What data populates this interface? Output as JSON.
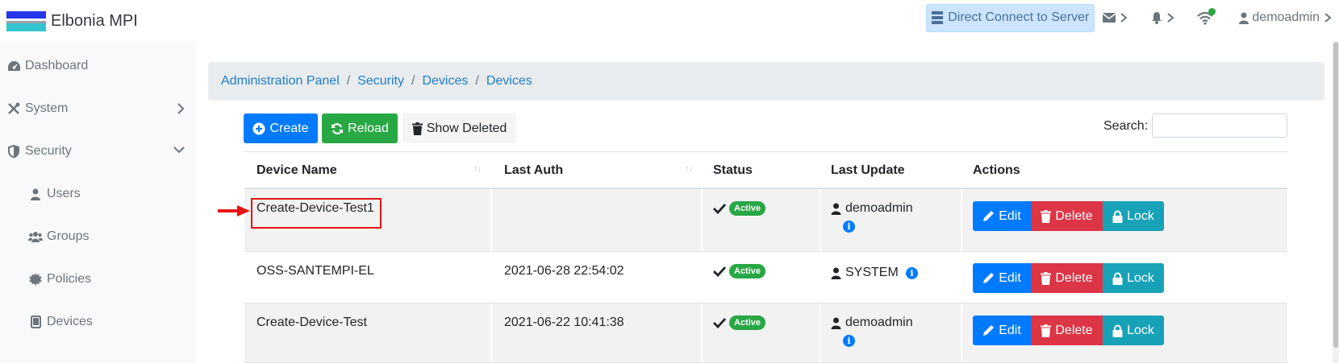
{
  "brand": {
    "name": "Elbonia MPI",
    "flag_colors": [
      "#2437e8",
      "#ffffff",
      "#33c5cf"
    ]
  },
  "topnav": {
    "direct_connect_label": "Direct Connect to Server",
    "user_label": "demoadmin",
    "status_dot_color": "#28a745"
  },
  "sidebar": {
    "items": [
      {
        "label": "Dashboard",
        "icon": "dashboard-icon"
      },
      {
        "label": "System",
        "icon": "tools-icon"
      },
      {
        "label": "Security",
        "icon": "shield-icon"
      },
      {
        "label": "Users",
        "icon": "user-icon"
      },
      {
        "label": "Groups",
        "icon": "users-icon"
      },
      {
        "label": "Policies",
        "icon": "certificate-icon"
      },
      {
        "label": "Devices",
        "icon": "tablet-icon"
      }
    ]
  },
  "breadcrumb": [
    "Administration Panel",
    "Security",
    "Devices",
    "Devices"
  ],
  "toolbar": {
    "create_label": "Create",
    "reload_label": "Reload",
    "show_deleted_label": "Show Deleted",
    "search_label": "Search:",
    "search_value": ""
  },
  "table": {
    "headers": [
      "Device Name",
      "Last Auth",
      "Status",
      "Last Update",
      "Actions"
    ],
    "rows": [
      {
        "name": "Create-Device-Test1",
        "last_auth": "",
        "status": "Active",
        "updated_by": "demoadmin"
      },
      {
        "name": "OSS-SANTEMPI-EL",
        "last_auth": "2021-06-28 22:54:02",
        "status": "Active",
        "updated_by": "SYSTEM"
      },
      {
        "name": "Create-Device-Test",
        "last_auth": "2021-06-22 10:41:38",
        "status": "Active",
        "updated_by": "demoadmin"
      }
    ],
    "action_labels": {
      "edit": "Edit",
      "delete": "Delete",
      "lock": "Lock"
    }
  },
  "colors": {
    "primary": "#007bff",
    "success": "#28a745",
    "danger": "#dc3545",
    "info": "#17a2b8",
    "highlight": "#e51414"
  }
}
